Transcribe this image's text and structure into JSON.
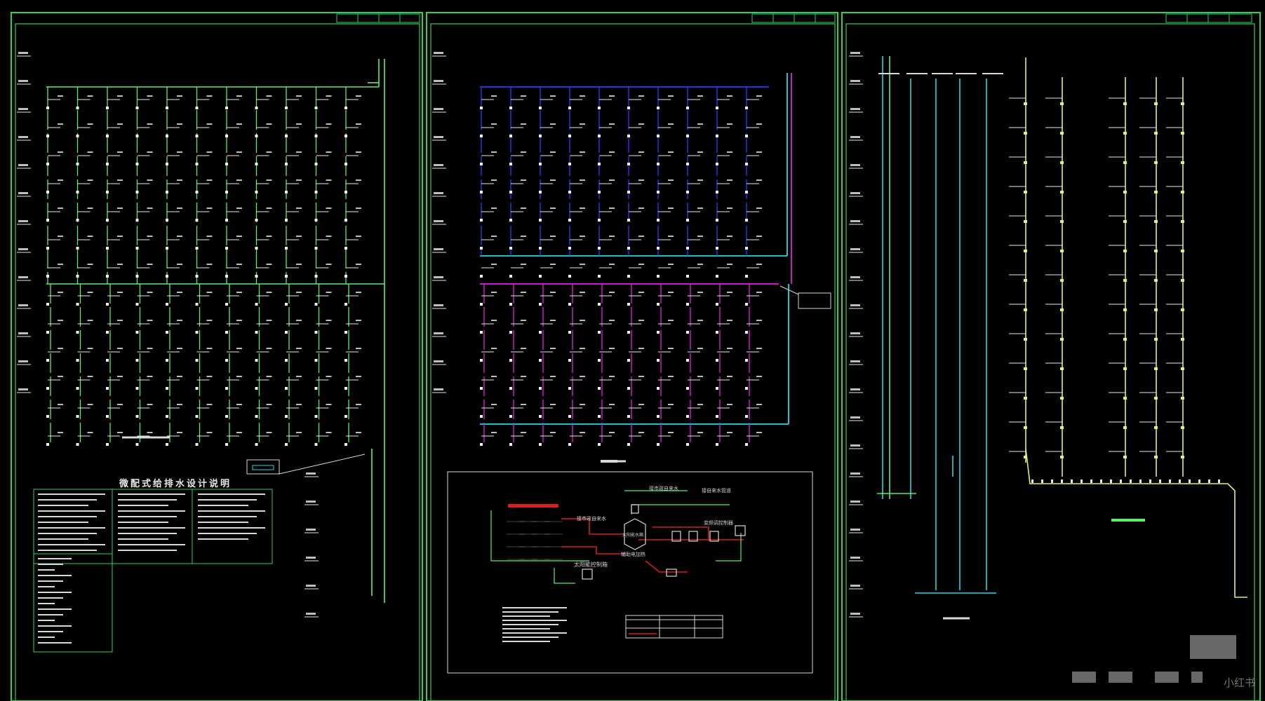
{
  "drawing": {
    "left_panel_title": "微配式给排水设计说明",
    "solar_caption": "太阳能控制箱",
    "hydrant_caption": "接市政自来水",
    "aux_caption": "辅助电加热",
    "heater_caption": "变频调控制器",
    "water_in_caption": "接自来水管道",
    "hot_out_caption": "接市政自来水",
    "tank_caption": "太阳能水箱"
  },
  "watermark": "小红书",
  "colors": {
    "background": "#000000",
    "frame": "#2fd25a",
    "pipe_green": "#5cf06a",
    "pipe_blue": "#2a3cff",
    "pipe_magenta": "#e020e0",
    "pipe_cyan": "#22d8e8",
    "pipe_yellow": "#e6ec7a",
    "pipe_red": "#d02020",
    "text": "#e8e8e8"
  }
}
